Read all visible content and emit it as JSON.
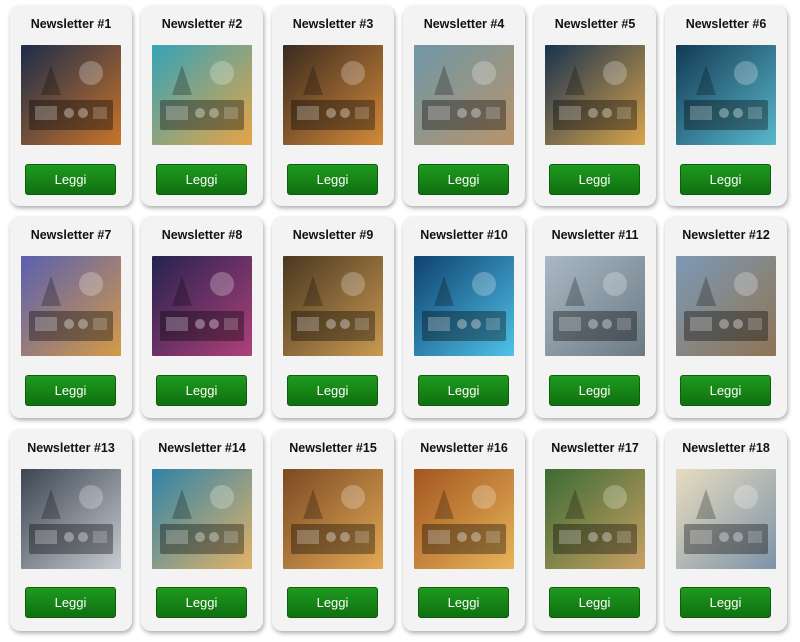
{
  "cards": [
    {
      "title": "Newsletter #1",
      "button": "Leggi",
      "image": "operator-at-radio-station-cloud",
      "c1": "#1c2c4a",
      "c2": "#c9742a"
    },
    {
      "title": "Newsletter #2",
      "button": "Leggi",
      "image": "cloud-server-operator",
      "c1": "#34a3b8",
      "c2": "#e7a445"
    },
    {
      "title": "Newsletter #3",
      "button": "Leggi",
      "image": "bearded-operator-globe-screen",
      "c1": "#3a2a20",
      "c2": "#d48a3a"
    },
    {
      "title": "Newsletter #4",
      "button": "Leggi",
      "image": "vintage-radio-equipment-city",
      "c1": "#6f97a8",
      "c2": "#b9936a"
    },
    {
      "title": "Newsletter #5",
      "button": "Leggi",
      "image": "night-landscape-radio-operator",
      "c1": "#19324f",
      "c2": "#d9a44b"
    },
    {
      "title": "Newsletter #6",
      "button": "Leggi",
      "image": "easylog-control-room",
      "c1": "#123a54",
      "c2": "#59b8cc"
    },
    {
      "title": "Newsletter #7",
      "button": "Leggi",
      "image": "easylog-reserved-area-vault",
      "c1": "#5a5fb0",
      "c2": "#d49a45"
    },
    {
      "title": "Newsletter #8",
      "button": "Leggi",
      "image": "operator-at-night-moon",
      "c1": "#24234f",
      "c2": "#b0407a"
    },
    {
      "title": "Newsletter #9",
      "button": "Leggi",
      "image": "vintage-operators-room",
      "c1": "#4a3720",
      "c2": "#c99a52"
    },
    {
      "title": "Newsletter #10",
      "button": "Leggi",
      "image": "hands-holding-globe",
      "c1": "#0e4170",
      "c2": "#4fc2e8"
    },
    {
      "title": "Newsletter #11",
      "button": "Leggi",
      "image": "antenna-tower-radio",
      "c1": "#a9b8c4",
      "c2": "#6c7a84"
    },
    {
      "title": "Newsletter #12",
      "button": "Leggi",
      "image": "castle-antenna",
      "c1": "#7d99b5",
      "c2": "#8f7453"
    },
    {
      "title": "Newsletter #13",
      "button": "Leggi",
      "image": "easylog-classroom",
      "c1": "#3c4552",
      "c2": "#c7ccd2"
    },
    {
      "title": "Newsletter #14",
      "button": "Leggi",
      "image": "beach-radio-binary",
      "c1": "#2f83a8",
      "c2": "#e2b368"
    },
    {
      "title": "Newsletter #15",
      "button": "Leggi",
      "image": "map-radio-laptop",
      "c1": "#7a4a22",
      "c2": "#e4a956"
    },
    {
      "title": "Newsletter #16",
      "button": "Leggi",
      "image": "hills-radio-table",
      "c1": "#a3561f",
      "c2": "#e8b55a"
    },
    {
      "title": "Newsletter #17",
      "button": "Leggi",
      "image": "tropical-hut-laptop",
      "c1": "#3b6b34",
      "c2": "#c9a063"
    },
    {
      "title": "Newsletter #18",
      "button": "Leggi",
      "image": "world-map-antenna-sketch",
      "c1": "#e8dcc0",
      "c2": "#7c93a8"
    }
  ]
}
